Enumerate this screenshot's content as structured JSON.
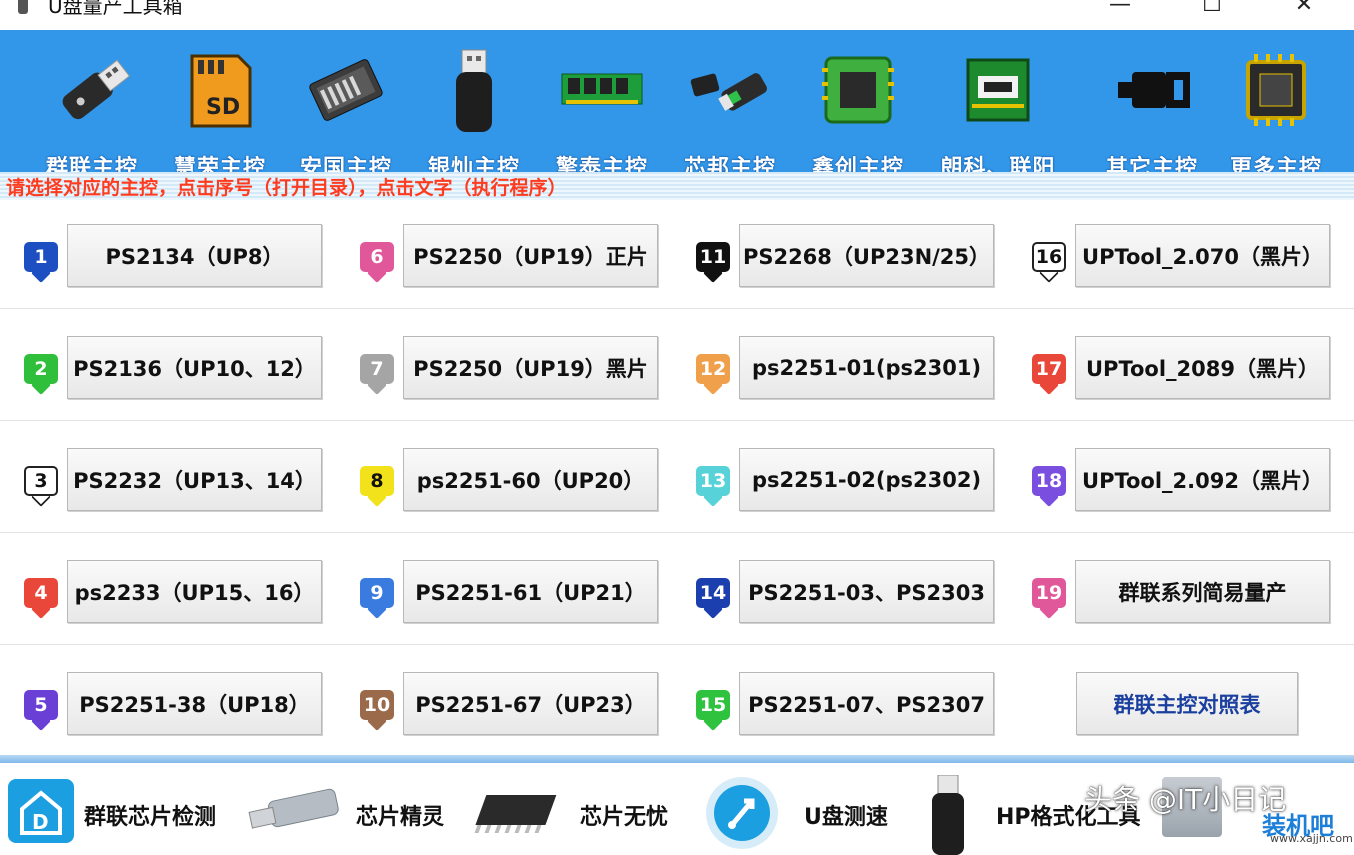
{
  "window": {
    "title": "U盘量产工具箱",
    "minimize": "—",
    "maximize": "☐",
    "close": "✕"
  },
  "toolbar": {
    "items": [
      {
        "label": "群联主控",
        "icon": "usb-drive-icon"
      },
      {
        "label": "慧荣主控",
        "icon": "sd-card-icon"
      },
      {
        "label": "安国主控",
        "icon": "memory-card-icon"
      },
      {
        "label": "银灿主控",
        "icon": "usb-stick-icon"
      },
      {
        "label": "擎泰主控",
        "icon": "ram-module-icon"
      },
      {
        "label": "芯邦主控",
        "icon": "flash-drive-icon"
      },
      {
        "label": "鑫创主控",
        "icon": "chip-icon"
      },
      {
        "label": "朗科、联阳",
        "icon": "circuit-board-icon"
      },
      {
        "label": "其它主控",
        "icon": "usb-plug-icon"
      },
      {
        "label": "更多主控",
        "icon": "processor-icon"
      }
    ]
  },
  "hint": "请选择对应的主控，点击序号（打开目录），点击文字（执行程序）",
  "controllers": [
    {
      "num": "1",
      "label": "PS2134（UP8）",
      "color": "#1e4fc2"
    },
    {
      "num": "2",
      "label": "PS2136（UP10、12）",
      "color": "#2fbf3a"
    },
    {
      "num": "3",
      "label": "PS2232（UP13、14）",
      "color": "#ffffff"
    },
    {
      "num": "4",
      "label": "ps2233（UP15、16）",
      "color": "#e8473a"
    },
    {
      "num": "5",
      "label": "PS2251-38（UP18）",
      "color": "#6a3fd6"
    },
    {
      "num": "6",
      "label": "PS2250（UP19）正片",
      "color": "#e0589a"
    },
    {
      "num": "7",
      "label": "PS2250（UP19）黑片",
      "color": "#a5a5a5"
    },
    {
      "num": "8",
      "label": "ps2251-60（UP20）",
      "color": "#f2e21c"
    },
    {
      "num": "9",
      "label": "PS2251-61（UP21）",
      "color": "#3a7be0"
    },
    {
      "num": "10",
      "label": "PS2251-67（UP23）",
      "color": "#9a6a4a"
    },
    {
      "num": "11",
      "label": "PS2268（UP23N/25）",
      "color": "#111111"
    },
    {
      "num": "12",
      "label": "ps2251-01(ps2301)",
      "color": "#f0a04a"
    },
    {
      "num": "13",
      "label": "ps2251-02(ps2302)",
      "color": "#57d2d8"
    },
    {
      "num": "14",
      "label": "PS2251-03、PS2303",
      "color": "#1b3fae"
    },
    {
      "num": "15",
      "label": "PS2251-07、PS2307",
      "color": "#2fc23f"
    },
    {
      "num": "16",
      "label": "UPTool_2.070（黑片）",
      "color": "#ffffff"
    },
    {
      "num": "17",
      "label": "UPTool_2089（黑片）",
      "color": "#e8473a"
    },
    {
      "num": "18",
      "label": "UPTool_2.092（黑片）",
      "color": "#7a4fe0"
    },
    {
      "num": "19",
      "label": "群联系列简易量产",
      "color": "#e0589a"
    }
  ],
  "compare_button": "群联主控对照表",
  "bottom": {
    "items": [
      {
        "label": "群联芯片检测",
        "icon": "house-d-icon"
      },
      {
        "label": "芯片精灵",
        "icon": "usb-metal-drive-icon"
      },
      {
        "label": "芯片无忧",
        "icon": "ic-chip-icon"
      },
      {
        "label": "U盘测速",
        "icon": "usb-speed-icon"
      },
      {
        "label": "HP格式化工具",
        "icon": "black-usb-icon"
      }
    ]
  },
  "watermark": {
    "text": "头条 @IT小日记",
    "logo": "装机吧",
    "url": "www.xajjn.com"
  }
}
